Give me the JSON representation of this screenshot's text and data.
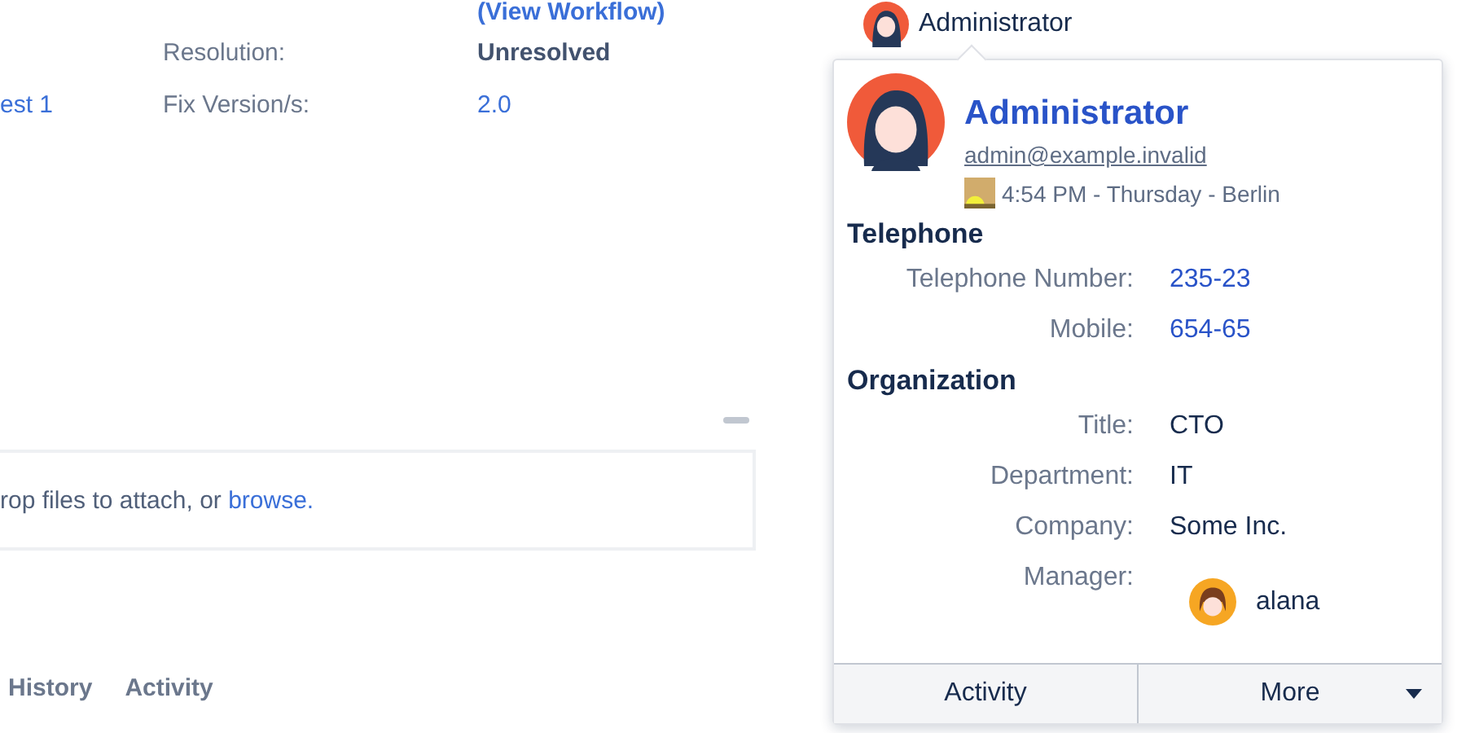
{
  "background": {
    "workflow_link": "(View Workflow)",
    "fields": [
      {
        "label": "Resolution:",
        "value": "Unresolved",
        "kind": "text"
      },
      {
        "prefix": "est 1",
        "label": "Fix Version/s:",
        "value": "2.0",
        "kind": "link"
      }
    ],
    "drop_zone": {
      "text": "rop files to attach, or ",
      "link": "browse."
    },
    "tabs": [
      "History",
      "Activity"
    ]
  },
  "trigger": {
    "name": "Administrator"
  },
  "card": {
    "name": "Administrator",
    "email": "admin@example.invalid",
    "local_time": "4:54 PM - Thursday - Berlin",
    "sections": [
      {
        "title": "Telephone",
        "rows": [
          {
            "label": "Telephone Number:",
            "value": "235-23",
            "kind": "link"
          },
          {
            "label": "Mobile:",
            "value": "654-65",
            "kind": "link"
          }
        ]
      },
      {
        "title": "Organization",
        "rows": [
          {
            "label": "Title:",
            "value": "CTO",
            "kind": "text"
          },
          {
            "label": "Department:",
            "value": "IT",
            "kind": "text"
          },
          {
            "label": "Company:",
            "value": "Some Inc.",
            "kind": "text"
          },
          {
            "label": "Manager:",
            "value": "alana",
            "kind": "user"
          }
        ]
      }
    ],
    "buttons": [
      {
        "label": "Activity",
        "kind": "plain"
      },
      {
        "label": "More",
        "kind": "dropdown"
      }
    ]
  }
}
